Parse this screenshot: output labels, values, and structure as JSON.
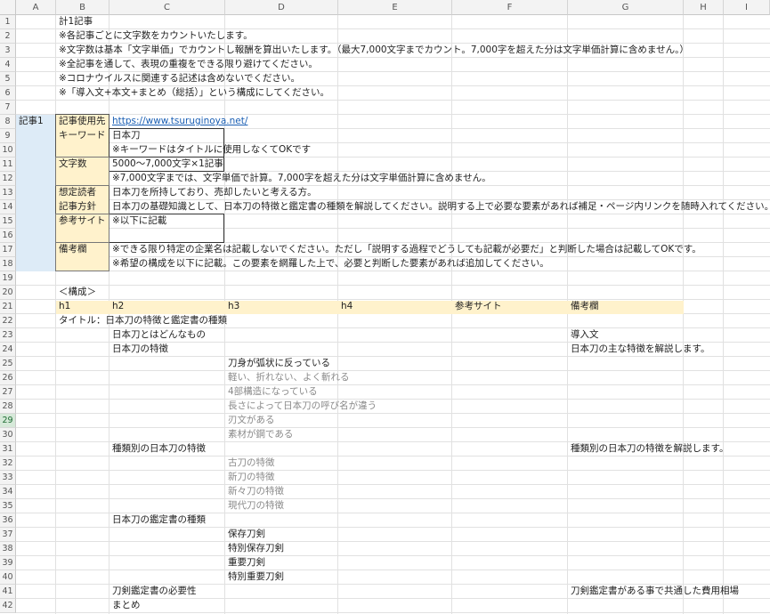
{
  "columns": [
    "A",
    "B",
    "C",
    "D",
    "E",
    "F",
    "G",
    "H",
    "I"
  ],
  "rows": [
    "1",
    "2",
    "3",
    "4",
    "5",
    "6",
    "7",
    "8",
    "9",
    "10",
    "11",
    "12",
    "13",
    "14",
    "15",
    "16",
    "17",
    "18",
    "19",
    "20",
    "21",
    "22",
    "23",
    "24",
    "25",
    "26",
    "27",
    "28",
    "29",
    "30",
    "31",
    "32",
    "33",
    "34",
    "35",
    "36",
    "37",
    "38",
    "39",
    "40",
    "41",
    "42"
  ],
  "selected_row": "29",
  "header_notes": {
    "r1": "計1記事",
    "r2": "※各記事ごとに文字数をカウントいたします。",
    "r3": "※文字数は基本「文字単価」でカウントし報酬を算出いたします。（最大7,000文字までカウント。7,000字を超えた分は文字単価計算に含めません。）",
    "r4": "※全記事を通して、表現の重複をできる限り避けてください。",
    "r5": "※コロナウイルスに関連する記述は含めないでください。",
    "r6": "※「導入文+本文+まとめ（総括）」という構成にしてください。"
  },
  "article": {
    "label": "記事1",
    "site_label": "記事使用先",
    "site_url": "https://www.tsuruginoya.net/",
    "keyword_label": "キーワード",
    "keyword_value": "日本刀",
    "keyword_note": "※キーワードはタイトルに使用しなくてOKです",
    "count_label": "文字数",
    "count_value": "5000～7,000文字×1記事",
    "count_note": "※7,000文字までは、文字単価で計算。7,000字を超えた分は文字単価計算に含めません。",
    "reader_label": "想定読者",
    "reader_value": "日本刀を所持しており、売却したいと考える方。",
    "policy_label": "記事方針",
    "policy_value": "日本刀の基礎知識として、日本刀の特徴と鑑定書の種類を解説してください。説明する上で必要な要素があれば補足・ページ内リンクを随時入れてください。",
    "ref_label": "参考サイト",
    "ref_value": "※以下に記載",
    "remarks_label": "備考欄",
    "remarks_1": "※できる限り特定の企業名は記載しないでください。ただし「説明する過程でどうしても記載が必要だ」と判断した場合は記載してOKです。",
    "remarks_2": "※希望の構成を以下に記載。この要素を網羅した上で、必要と判断した要素があれば追加してください。"
  },
  "structure": {
    "heading": "＜構成＞",
    "col_h1": "h1",
    "col_h2": "h2",
    "col_h3": "h3",
    "col_h4": "h4",
    "col_ref": "参考サイト",
    "col_remarks": "備考欄",
    "title": "タイトル：日本刀の特徴と鑑定書の種類",
    "r23_h2": "日本刀とはどんなもの",
    "r23_remark": "導入文",
    "r24_h2": "日本刀の特徴",
    "r24_remark": "日本刀の主な特徴を解説します。",
    "r25_h3": "刀身が弧状に反っている",
    "r26_h3": "軽い、折れない、よく斬れる",
    "r27_h3": "4部構造になっている",
    "r28_h3": "長さによって日本刀の呼び名が違う",
    "r29_h3": "刃文がある",
    "r30_h3": "素材が鋼である",
    "r31_h2": "種類別の日本刀の特徴",
    "r31_remark": "種類別の日本刀の特徴を解説します。",
    "r32_h3": "古刀の特徴",
    "r33_h3": "新刀の特徴",
    "r34_h3": "新々刀の特徴",
    "r35_h3": "現代刀の特徴",
    "r36_h2": "日本刀の鑑定書の種類",
    "r37_h3": "保存刀剣",
    "r38_h3": "特別保存刀剣",
    "r39_h3": "重要刀剣",
    "r40_h3": "特別重要刀剣",
    "r41_h2": "刀剣鑑定書の必要性",
    "r41_remark": "刀剣鑑定書がある事で共通した費用相場",
    "r42_h2": "まとめ"
  }
}
